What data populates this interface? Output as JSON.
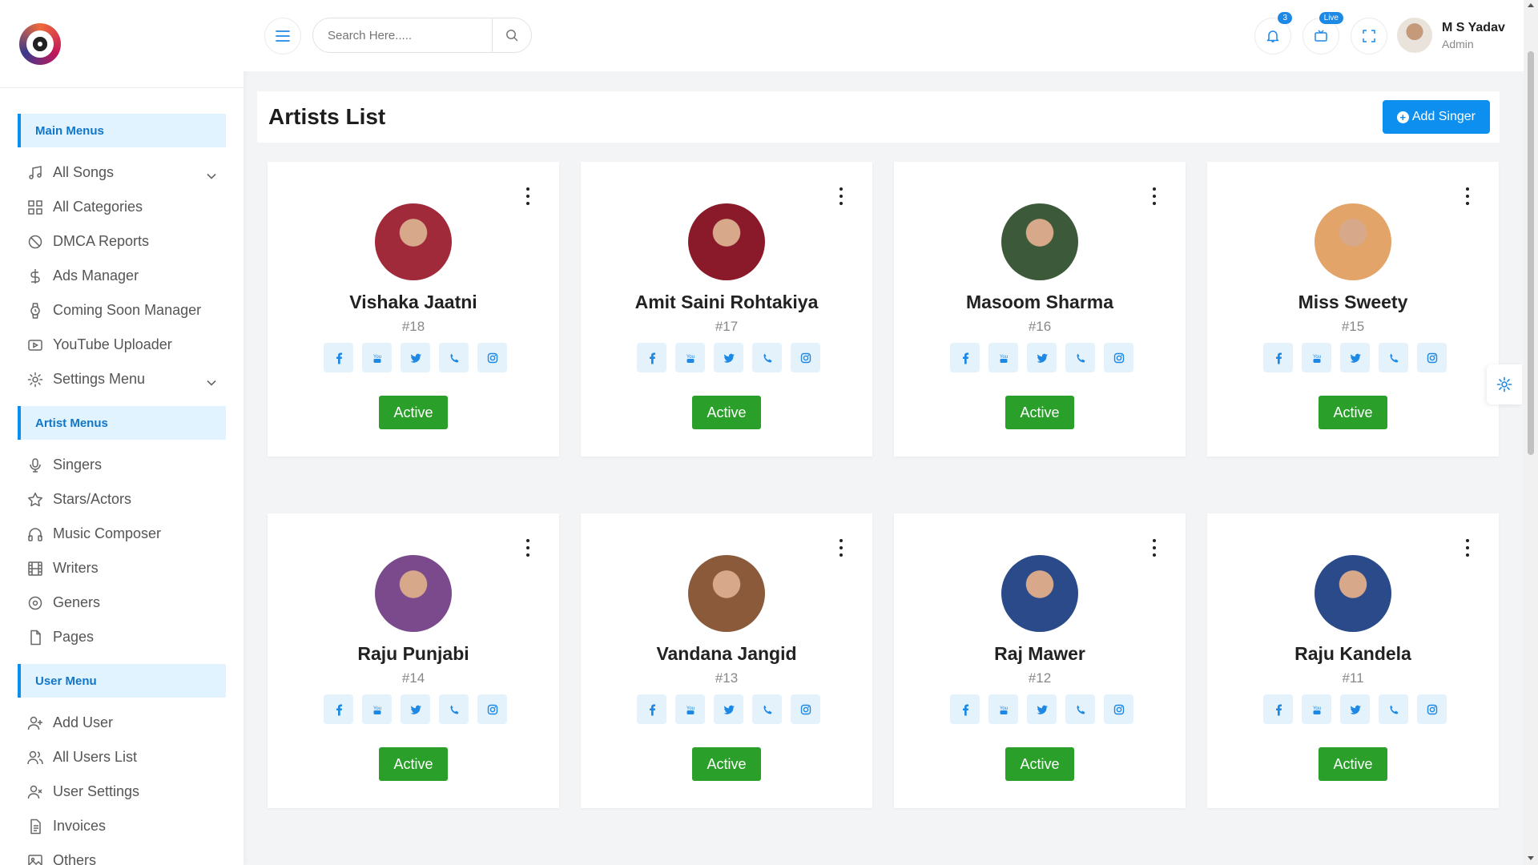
{
  "sidebar": {
    "sections": [
      {
        "title": "Main Menus"
      },
      {
        "title": "Artist Menus"
      },
      {
        "title": "User Menu"
      }
    ],
    "main_items": [
      {
        "label": "All Songs",
        "icon": "music-note-icon",
        "expandable": true
      },
      {
        "label": "All Categories",
        "icon": "grid-icon"
      },
      {
        "label": "DMCA Reports",
        "icon": "ban-icon"
      },
      {
        "label": "Ads Manager",
        "icon": "dollar-icon"
      },
      {
        "label": "Coming Soon Manager",
        "icon": "watch-icon"
      },
      {
        "label": "YouTube Uploader",
        "icon": "youtube-icon"
      },
      {
        "label": "Settings Menu",
        "icon": "gear-icon",
        "expandable": true
      }
    ],
    "artist_items": [
      {
        "label": "Singers",
        "icon": "microphone-icon"
      },
      {
        "label": "Stars/Actors",
        "icon": "star-icon"
      },
      {
        "label": "Music Composer",
        "icon": "headphones-icon"
      },
      {
        "label": "Writers",
        "icon": "film-icon"
      },
      {
        "label": "Geners",
        "icon": "disc-icon"
      },
      {
        "label": "Pages",
        "icon": "file-icon"
      }
    ],
    "user_items": [
      {
        "label": "Add User",
        "icon": "user-plus-icon"
      },
      {
        "label": "All Users List",
        "icon": "users-icon"
      },
      {
        "label": "User Settings",
        "icon": "user-x-icon"
      },
      {
        "label": "Invoices",
        "icon": "invoice-icon"
      },
      {
        "label": "Others",
        "icon": "image-icon"
      }
    ]
  },
  "topbar": {
    "search_placeholder": "Search Here.....",
    "notification_count": "3",
    "live_label": "Live",
    "user_name": "M S Yadav",
    "user_role": "Admin"
  },
  "page": {
    "title": "Artists List",
    "add_button": "Add Singer"
  },
  "artists": [
    {
      "name": "Vishaka Jaatni",
      "id": "#18",
      "status": "Active",
      "avatar_color": "#a02a3a"
    },
    {
      "name": "Amit Saini Rohtakiya",
      "id": "#17",
      "status": "Active",
      "avatar_color": "#8a1a2a"
    },
    {
      "name": "Masoom Sharma",
      "id": "#16",
      "status": "Active",
      "avatar_color": "#3c5a3a"
    },
    {
      "name": "Miss Sweety",
      "id": "#15",
      "status": "Active",
      "avatar_color": "#e3a46a"
    },
    {
      "name": "Raju Punjabi",
      "id": "#14",
      "status": "Active",
      "avatar_color": "#7a4a8c"
    },
    {
      "name": "Vandana Jangid",
      "id": "#13",
      "status": "Active",
      "avatar_color": "#8a5a3a"
    },
    {
      "name": "Raj Mawer",
      "id": "#12",
      "status": "Active",
      "avatar_color": "#2a4a8a"
    },
    {
      "name": "Raju Kandela",
      "id": "#11",
      "status": "Active",
      "avatar_color": "#2a4a8a"
    }
  ],
  "social_icons": [
    "facebook-icon",
    "youtube-icon",
    "twitter-icon",
    "phone-icon",
    "instagram-icon"
  ],
  "colors": {
    "accent": "#0d8ff0",
    "active": "#2aa02a",
    "menu_header_bg": "#e0f3ff"
  }
}
